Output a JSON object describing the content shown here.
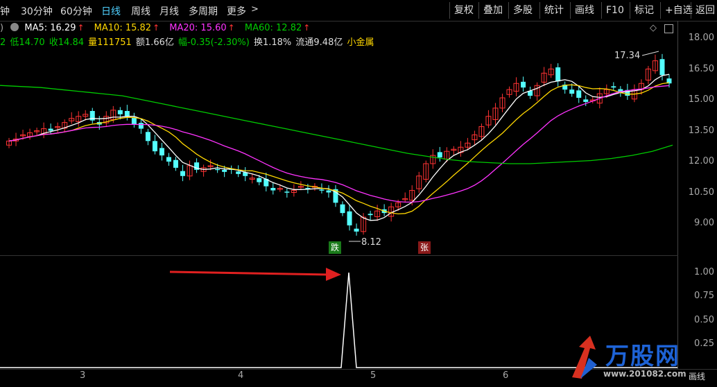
{
  "periods": [
    "钟",
    "30分钟",
    "60分钟",
    "日线",
    "周线",
    "月线",
    "多周期",
    "更多"
  ],
  "active_period": "日线",
  "toolbar": [
    "复权",
    "叠加",
    "多股",
    "统计",
    "画线",
    "F10",
    "标记",
    "+自选",
    "返回"
  ],
  "ma": {
    "prefix": ")",
    "ma5": "MA5: 16.29",
    "ma10": "MA10: 15.82",
    "ma20": "MA20: 15.60",
    "ma60": "MA60: 12.82",
    "arrow": "↑"
  },
  "quote": {
    "open": "2",
    "low": "低14.70",
    "close": "收14.84",
    "volume": "量111751",
    "amount": "额1.66亿",
    "change": "幅-0.35(-2.30%)",
    "turnover": "换1.18%",
    "float": "流通9.48亿",
    "sector": "小金属"
  },
  "y_axis_main": [
    "18.00",
    "16.50",
    "15.00",
    "13.50",
    "12.00",
    "10.50",
    "9.00"
  ],
  "y_axis_sub": [
    "1.00",
    "0.75",
    "0.50",
    "0.25"
  ],
  "x_axis": [
    "3",
    "4",
    "5",
    "6"
  ],
  "annotations": {
    "high": "17.34",
    "low": "8.12",
    "fall_tag": "跌",
    "rise_tag": "张"
  },
  "bottom_right": "画线",
  "colors": {
    "ma5": "#ffffff",
    "ma10": "#ffd700",
    "ma20": "#ff33ff",
    "ma60": "#00cc00",
    "up": "#ff3333",
    "down": "#54ffff"
  },
  "watermark": {
    "brand": "万股网",
    "url": "www.201082.com"
  }
}
